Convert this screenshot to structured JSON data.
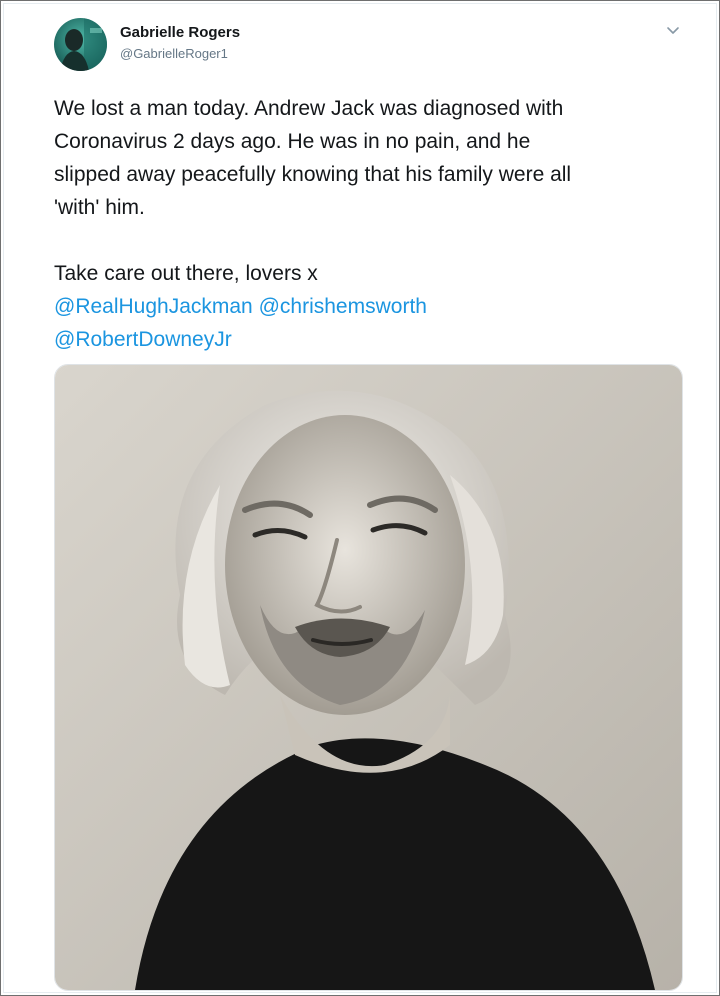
{
  "author": {
    "name": "Gabrielle Rogers",
    "handle": "@GabrielleRoger1"
  },
  "tweet": {
    "line1": "We lost a man today. Andrew Jack was diagnosed with",
    "line2": "Coronavirus 2 days ago. He was in no pain, and he",
    "line3": "slipped away peacefully knowing that his family were all",
    "line4": "'with' him.",
    "line5": "Take care out there, lovers x",
    "mentions": [
      "@RealHughJackman",
      "@chrishemsworth",
      "@RobertDowneyJr"
    ]
  },
  "icons": {
    "caret": "chevron-down-icon",
    "avatar": "avatar-photo",
    "media": "portrait-photo"
  },
  "colors": {
    "link": "#1b95e0",
    "text": "#14171a",
    "secondary": "#657786"
  }
}
